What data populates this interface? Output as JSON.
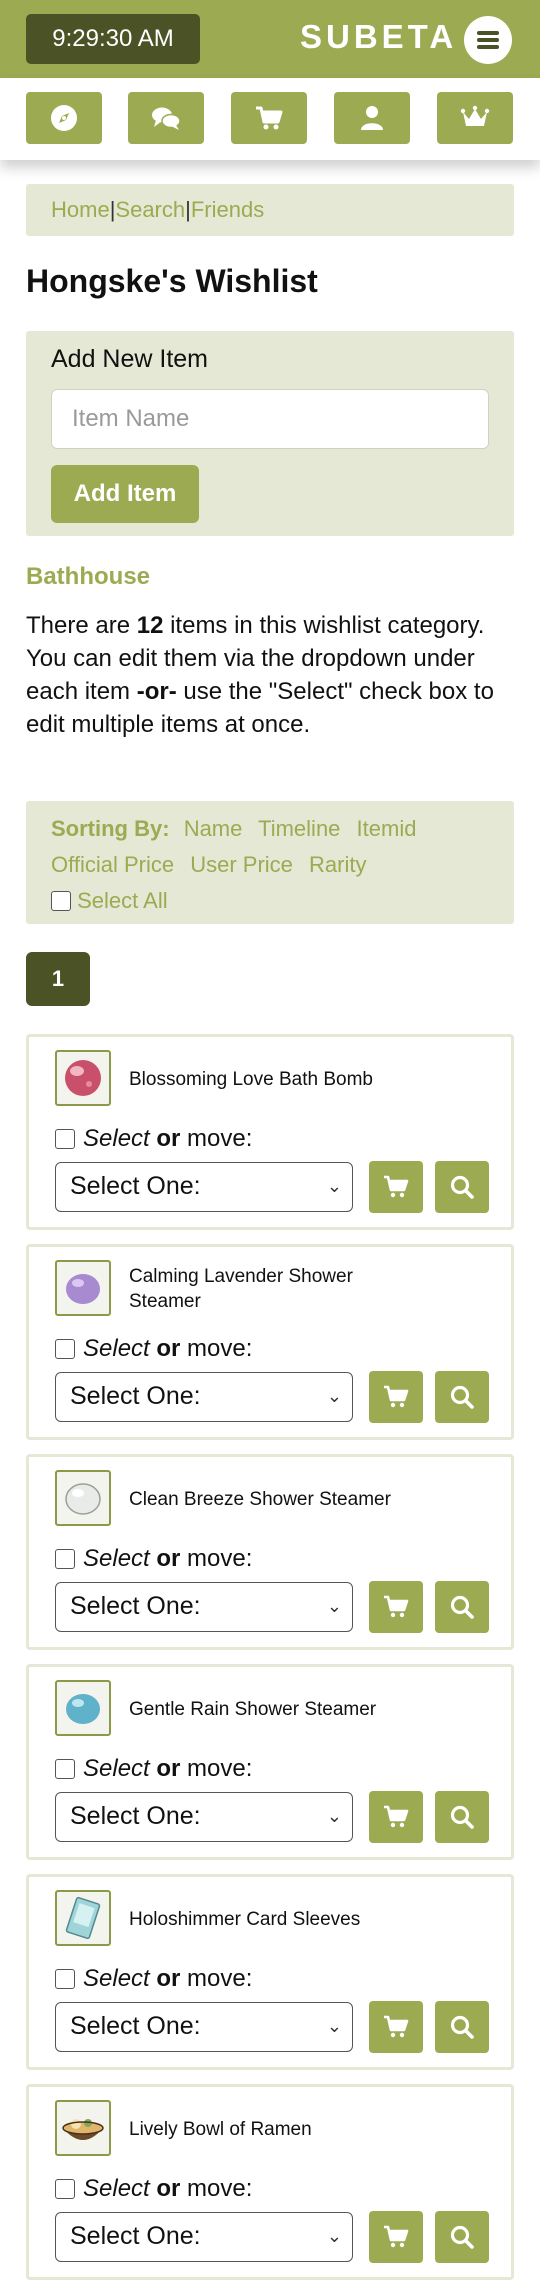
{
  "header": {
    "time": "9:29:30 AM",
    "brand": "SUBETA"
  },
  "nav": [
    "compass-icon",
    "chat-icon",
    "cart-icon",
    "user-icon",
    "crown-icon"
  ],
  "breadcrumb": {
    "home": "Home",
    "search": "Search",
    "friends": "Friends",
    "separator": "|"
  },
  "page_title": "Hongske's Wishlist",
  "add_item": {
    "label": "Add New Item",
    "placeholder": "Item Name",
    "button": "Add Item"
  },
  "category": "Bathhouse",
  "description": {
    "pre": "There are ",
    "count": "12",
    "mid": " items in this wishlist category. You can edit them via the dropdown under each item ",
    "or": "-or-",
    "post": " use the \"Select\" check box to edit multiple items at once."
  },
  "sorting": {
    "label": "Sorting By:",
    "options": [
      "Name",
      "Timeline",
      "Itemid",
      "Official Price",
      "User Price",
      "Rarity"
    ],
    "select_all": "Select All"
  },
  "pagination": {
    "current": "1"
  },
  "item_controls": {
    "select": "Select",
    "or": "or",
    "move": "move:",
    "dropdown": "Select One:"
  },
  "items": [
    {
      "name": "Blossoming Love Bath Bomb"
    },
    {
      "name": "Calming Lavender Shower Steamer"
    },
    {
      "name": "Clean Breeze Shower Steamer"
    },
    {
      "name": "Gentle Rain Shower Steamer"
    },
    {
      "name": "Holoshimmer Card Sleeves"
    },
    {
      "name": "Lively Bowl of Ramen"
    }
  ],
  "colors": {
    "brand": "#9caa52",
    "dark": "#4b5225",
    "panel": "#e4e8d4"
  }
}
